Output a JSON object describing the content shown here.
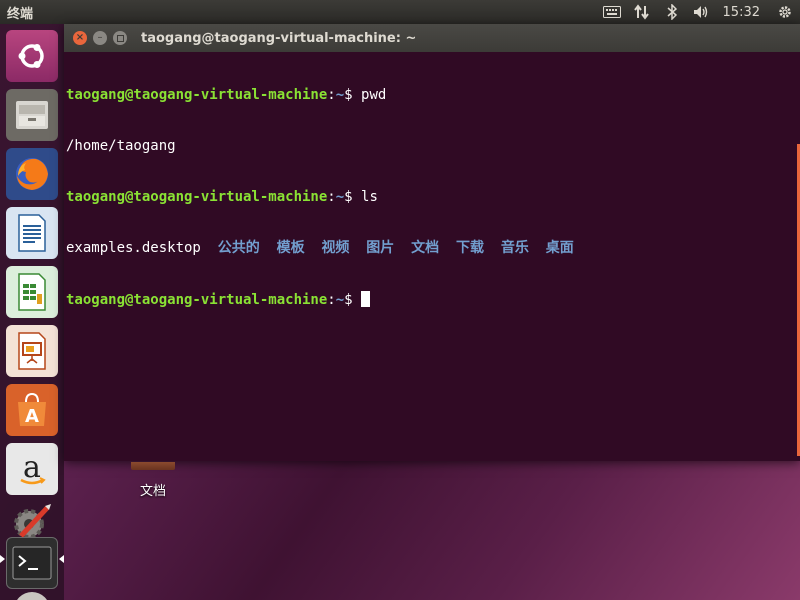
{
  "top_panel": {
    "app_title": "终端",
    "clock": "15:32",
    "icons": [
      "keyboard-icon",
      "network-icon",
      "bluetooth-icon",
      "volume-icon",
      "gear-icon"
    ]
  },
  "launcher": {
    "items": [
      "ubuntu-dash",
      "files",
      "firefox",
      "libreoffice-writer",
      "libreoffice-calc",
      "libreoffice-impress",
      "ubuntu-software",
      "amazon",
      "system-settings",
      "terminal",
      "dvd"
    ],
    "active": "terminal"
  },
  "window": {
    "title": "taogang@taogang-virtual-machine: ~",
    "lines": [
      {
        "prompt": "taogang@taogang-virtual-machine",
        "path": "~",
        "command": "pwd"
      },
      {
        "output": "/home/taogang"
      },
      {
        "prompt": "taogang@taogang-virtual-machine",
        "path": "~",
        "command": "ls"
      },
      {
        "file": "examples.desktop",
        "dirs": [
          "公共的",
          "模板",
          "视频",
          "图片",
          "文档",
          "下载",
          "音乐",
          "桌面"
        ]
      },
      {
        "prompt": "taogang@taogang-virtual-machine",
        "path": "~",
        "command": ""
      }
    ]
  },
  "desktop": {
    "icon_label": "文档"
  },
  "colors": {
    "terminal_bg": "#300a24",
    "prompt_green": "#8ae234",
    "dir_blue": "#729fcf",
    "close_orange": "#e9663c"
  }
}
